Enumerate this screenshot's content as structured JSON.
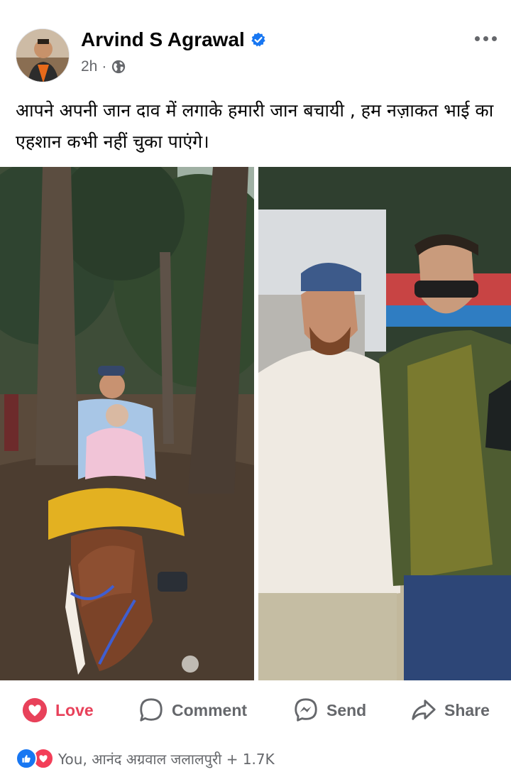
{
  "post": {
    "author": "Arvind S Agrawal",
    "time": "2h",
    "separator": "·",
    "caption": "आपने अपनी जान दाव में  लगाके हमारी जान बचायी , हम नज़ाकत भाई का एहशान कभी नहीं चुका पाएंगे।"
  },
  "icons": {
    "verified": "verified-badge-icon",
    "audience": "globe-icon",
    "more": "more-options-icon",
    "love": "heart-icon",
    "comment": "comment-bubble-icon",
    "send": "messenger-icon",
    "share": "share-arrow-icon"
  },
  "actions": {
    "love": "Love",
    "comment": "Comment",
    "send": "Send",
    "share": "Share"
  },
  "reactions": {
    "summary": "You, आनंद अग्रवाल जलालपुरी + 1.7K"
  },
  "colors": {
    "love": "#e8415a",
    "verified": "#1877f2",
    "muted": "#65676b"
  }
}
